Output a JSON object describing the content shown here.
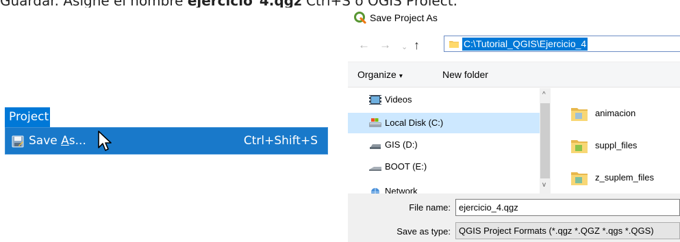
{
  "heading": {
    "prefix": "Guardar. Asigne el nombre ",
    "bold": "ejercicio_4.qgz",
    "suffix": " Ctrl+S o QGIS Project."
  },
  "project_menu": {
    "tab_label": "Project",
    "item": {
      "label_pre": "Save ",
      "label_ul": "A",
      "label_post": "s...",
      "shortcut": "Ctrl+Shift+S",
      "icon": "save-as-icon"
    },
    "colors": {
      "highlight": "#1979ca",
      "tab": "#0078d7"
    }
  },
  "dialog": {
    "title": "Save Project As",
    "address_path": "C:\\Tutorial_QGIS\\Ejercicio_4",
    "nav_glyphs": {
      "back": "←",
      "forward": "→",
      "recent": "⌄",
      "up": "↑"
    },
    "toolbar": {
      "organize": "Organize",
      "organize_caret": "▾",
      "new_folder": "New folder"
    },
    "nav_items": [
      {
        "label": "Videos",
        "icon": "videos-icon",
        "selected": false
      },
      {
        "label": "Local Disk (C:)",
        "icon": "local-disk-icon",
        "selected": true
      },
      {
        "label": "GIS (D:)",
        "icon": "drive-icon",
        "selected": false
      },
      {
        "label": "BOOT (E:)",
        "icon": "usb-drive-icon",
        "selected": false
      },
      {
        "label": "Network",
        "icon": "network-icon",
        "selected": false
      }
    ],
    "scroll_glyphs": {
      "up": "^",
      "down": "v"
    },
    "files": [
      {
        "name": "animacion",
        "icon": "folder-icon"
      },
      {
        "name": "suppl_files",
        "icon": "folder-icon"
      },
      {
        "name": "z_suplem_files",
        "icon": "folder-icon"
      }
    ],
    "file_name_label": "File name:",
    "file_name_value": "ejercicio_4.qgz",
    "save_type_label": "Save as type:",
    "save_type_value": "QGIS Project Formats (*.qgz *.QGZ *.qgs *.QGS)",
    "colors": {
      "selection": "#cde8ff",
      "path_highlight": "#0078d7"
    }
  }
}
